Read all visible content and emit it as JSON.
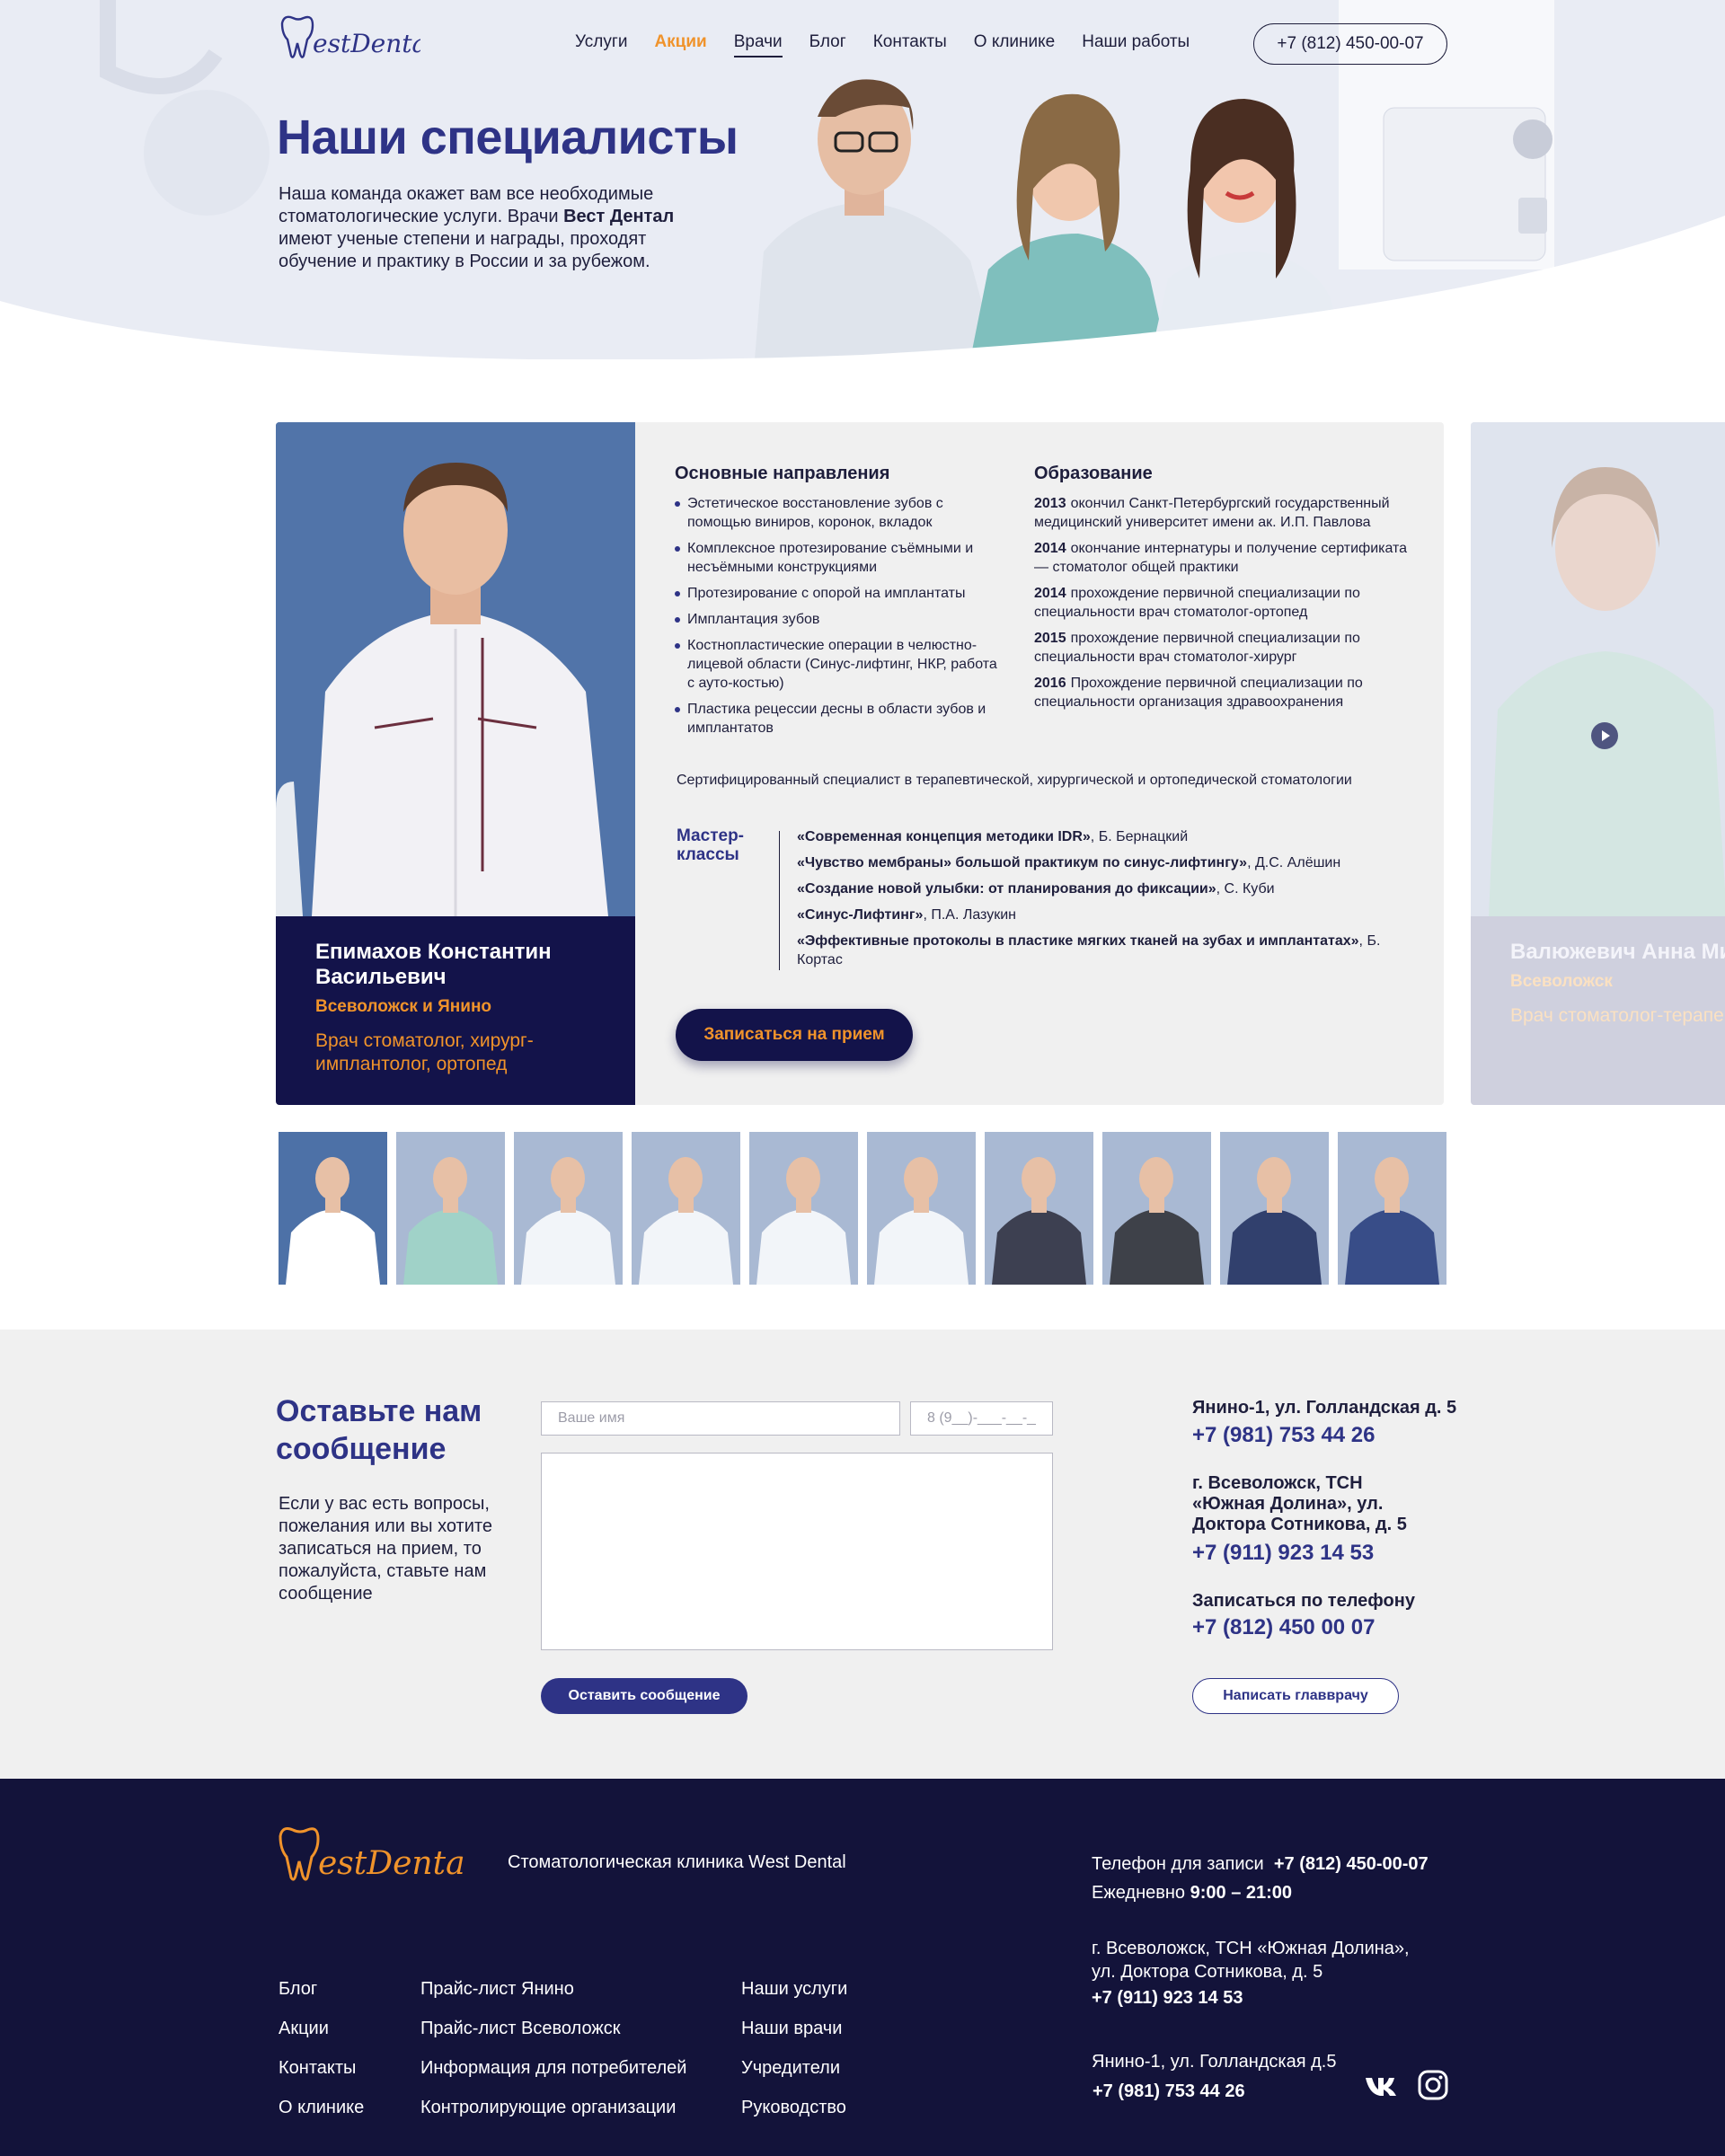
{
  "header": {
    "nav": [
      "Услуги",
      "Акции",
      "Врачи",
      "Блог",
      "Контакты",
      "О клинике",
      "Наши работы"
    ],
    "phone": "+7 (812) 450-00-07"
  },
  "hero": {
    "title": "Наши специалисты",
    "text_a": "Наша команда окажет вам все необходимые стоматологические услуги. Врачи ",
    "text_b": "Вест Дентал",
    "text_c": " имеют ученые степени и награды, проходят обучение и практику в России и за рубежом."
  },
  "doctor": {
    "name": "Епимахов Константин Васильевич",
    "city": "Всеволожск и Янино",
    "role": "Врач стоматолог, хирург-имплантолог, ортопед",
    "directions_title": "Основные направления",
    "directions": [
      "Эстетическое восстановление зубов с помощью виниров, коронок, вкладок",
      "Комплексное протезирование съёмными и несъёмными конструкциями",
      "Протезирование с опорой на имплантаты",
      "Имплантация зубов",
      "Костнопластические операции в челюстно-лицевой области (Синус-лифтинг, НКР, работа с ауто-костью)",
      "Пластика рецессии десны в области зубов и имплантатов"
    ],
    "education_title": "Образование",
    "education": [
      {
        "year": "2013",
        "text": "окончил Санкт-Петербургский государственный медицинский университет имени ак. И.П. Павлова"
      },
      {
        "year": "2014",
        "text": "окончание интернатуры и получение сертификата — стоматолог общей практики"
      },
      {
        "year": "2014",
        "text": "прохождение первичной специализации по специальности врач стоматолог-ортопед"
      },
      {
        "year": "2015",
        "text": "прохождение первичной специализации по специальности врач стоматолог-хирург"
      },
      {
        "year": "2016",
        "text": "Прохождение первичной специализации по специальности организация здравоохранения"
      }
    ],
    "certification": "Сертифицированный специалист в терапевтической, хирургической и ортопедической стоматологии",
    "masterclasses_title": "Мастер-классы",
    "masterclasses": [
      {
        "title": "«Современная концепция методики IDR»",
        "author": ", Б. Бернацкий"
      },
      {
        "title": "«Чувство мембраны» большой практикум по синус-лифтингу»",
        "author": ", Д.С. Алёшин"
      },
      {
        "title": "«Создание новой улыбки: от планирования до фиксации»",
        "author": ", С. Куби"
      },
      {
        "title": "«Синус-Лифтинг»",
        "author": ", П.А. Лазукин"
      },
      {
        "title": "«Эффективные протоколы в пластике мягких тканей на зубах и имплантатах»",
        "author": ", Б. Кортас"
      }
    ],
    "book_label": "Записаться на прием"
  },
  "next_doctor": {
    "name": "Валюжевич Анна Михайловна",
    "city": "Всеволожск",
    "role": "Врач стоматолог-терапевт"
  },
  "thumbnails": {
    "active_index": 0,
    "count": 10,
    "uniform_colors": [
      "#ffffff",
      "#9fd6c6",
      "#ffffff",
      "#ffffff",
      "#ffffff",
      "#ffffff",
      "#2a2a3a",
      "#2b2b30",
      "#1c2a5a",
      "#253a7a"
    ]
  },
  "contact_form": {
    "title": "Оставьте нам сообщение",
    "text": "Если у вас есть вопросы, пожелания или вы хотите записаться на прием, то пожалуйста, ставьте нам сообщение",
    "name_placeholder": "Ваше имя",
    "phone_placeholder": "8 (9__)-___-__-__",
    "send_label": "Оставить сообщение",
    "address_1": "Янино-1, ул. Голландская д. 5",
    "phone_1": "+7 (981) 753 44 26",
    "address_2": "г. Всеволожск, ТСН «Южная Долина», ул. Доктора Сотникова, д. 5",
    "phone_2": "+7 (911) 923 14 53",
    "call_label": "Записаться по телефону",
    "phone_3": "+7 (812) 450 00 07",
    "chief_label": "Написать главврачу"
  },
  "footer": {
    "tagline": "Стоматологическая клиника West Dental",
    "col1": [
      "Блог",
      "Акции",
      "Контакты",
      "О клинике"
    ],
    "col2": [
      "Прайс-лист Янино",
      "Прайс-лист Всеволожск",
      "Информация для потребителей",
      "Контролирующие организации"
    ],
    "col3": [
      "Наши услуги",
      "Наши врачи",
      "Учредители",
      "Руководство"
    ],
    "phone_label": "Телефон для записи",
    "phone": "+7 (812) 450-00-07",
    "hours_label": "Ежедневно",
    "hours": "9:00 – 21:00",
    "address_1": "г. Всеволожск, ТСН «Южная Долина», ул. Доктора Сотникова, д. 5",
    "phone_2": "+7 (911) 923 14 53",
    "address_2": "Янино-1, ул. Голландская д.5",
    "phone_3": "+7 (981) 753 44 26"
  },
  "colors": {
    "brand_navy": "#13134a",
    "brand_indigo": "#2e3386",
    "accent_orange": "#f0932b",
    "footer_bg": "#13133a",
    "section_bg": "#f0f0f0"
  },
  "icons": [
    "logo-tooth-icon",
    "play-icon",
    "vk-icon",
    "instagram-icon"
  ]
}
